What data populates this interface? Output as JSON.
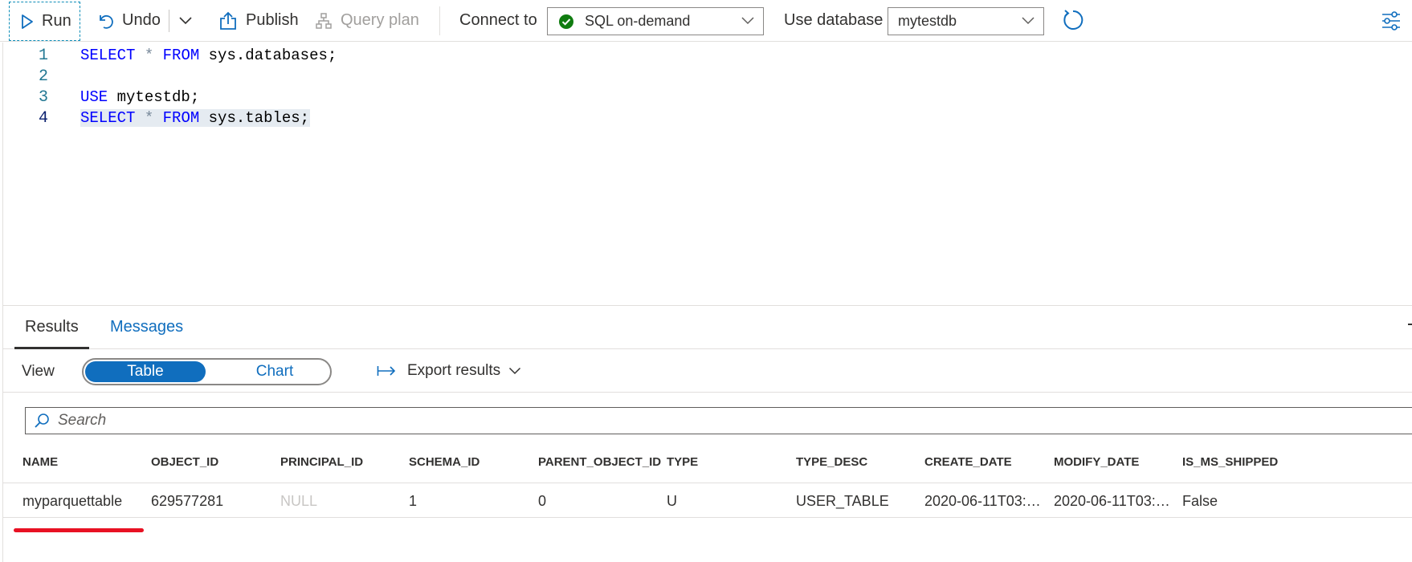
{
  "toolbar": {
    "run_label": "Run",
    "undo_label": "Undo",
    "publish_label": "Publish",
    "query_plan_label": "Query plan",
    "connect_label": "Connect to",
    "connect_value": "SQL on-demand",
    "use_database_label": "Use database",
    "database_value": "mytestdb"
  },
  "editor": {
    "lines": [
      {
        "number": "1",
        "tokens": [
          "SELECT",
          " * ",
          "FROM",
          " sys.databases;"
        ]
      },
      {
        "number": "2",
        "tokens": []
      },
      {
        "number": "3",
        "tokens": [
          "USE",
          " mytestdb;"
        ]
      },
      {
        "number": "4",
        "tokens": [
          "SELECT",
          " * ",
          "FROM",
          " sys.tables;"
        ]
      }
    ]
  },
  "results": {
    "tabs": {
      "results": "Results",
      "messages": "Messages"
    },
    "view_label": "View",
    "view_options": {
      "table": "Table",
      "chart": "Chart"
    },
    "export_label": "Export results",
    "search_placeholder": "Search",
    "columns": [
      "NAME",
      "OBJECT_ID",
      "PRINCIPAL_ID",
      "SCHEMA_ID",
      "PARENT_OBJECT_ID",
      "TYPE",
      "TYPE_DESC",
      "CREATE_DATE",
      "MODIFY_DATE",
      "IS_MS_SHIPPED"
    ],
    "rows": [
      [
        "myparquettable",
        "629577281",
        "NULL",
        "1",
        "0",
        "U",
        "USER_TABLE",
        "2020-06-11T03:1...",
        "2020-06-11T03:1...",
        "False"
      ]
    ]
  },
  "colors": {
    "accent": "#106ebe",
    "keyword": "#0000ff",
    "line_number": "#237893",
    "success": "#107c10",
    "annotation": "#e81123"
  }
}
